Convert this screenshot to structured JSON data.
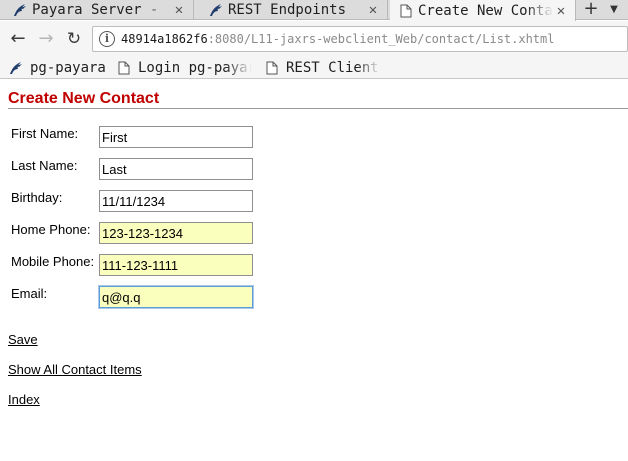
{
  "browser": {
    "tabs": [
      {
        "label": "Payara Server - ",
        "icon": "payara-fish-icon",
        "active": false
      },
      {
        "label": "REST Endpoints",
        "icon": "payara-fish-icon",
        "active": false
      },
      {
        "label": "Create New Contac",
        "icon": "page-icon",
        "active": true
      }
    ],
    "tab_close_glyph": "✕",
    "new_tab_glyph": "+",
    "tab_menu_glyph": "▼",
    "nav": {
      "back_glyph": "←",
      "forward_glyph": "→",
      "reload_glyph": "↻"
    },
    "url": {
      "info_glyph": "i",
      "host": "48914a1862f6",
      "rest": ":8080/L11-jaxrs-webclient_Web/contact/List.xhtml"
    },
    "bookmarks": [
      {
        "label": "pg-payara",
        "icon": "payara-fish-icon"
      },
      {
        "label": "Login pg-payara",
        "icon": "page-icon"
      },
      {
        "label": "REST Client For",
        "icon": "page-icon"
      }
    ]
  },
  "page": {
    "title": "Create New Contact",
    "fields": [
      {
        "label": "First Name:",
        "value": "First",
        "autofill": false
      },
      {
        "label": "Last Name:",
        "value": "Last",
        "autofill": false
      },
      {
        "label": "Birthday:",
        "value": "11/11/1234",
        "autofill": false
      },
      {
        "label": "Home Phone:",
        "value": "123-123-1234",
        "autofill": true
      },
      {
        "label": "Mobile Phone:",
        "value": "111-123-1111",
        "autofill": true
      },
      {
        "label": "Email:",
        "value": "q@q.q",
        "autofill": true
      }
    ],
    "links": {
      "save": "Save",
      "show_all": "Show All Contact Items",
      "index": "Index"
    }
  },
  "colors": {
    "title": "#c00000",
    "autofill_bg": "#faffbd",
    "focus_border": "#5b9dd9",
    "payara_icon": "#1f3c6b"
  }
}
